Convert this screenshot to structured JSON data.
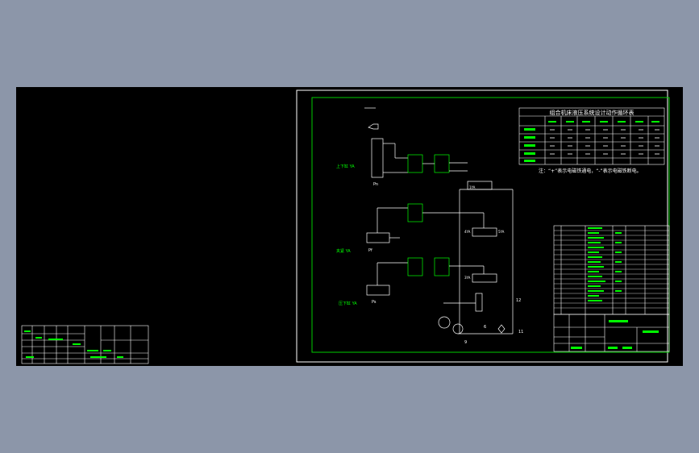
{
  "colors": {
    "background": "#8c96a9",
    "canvas": "#000000",
    "frame": "#ffffff",
    "border": "#00cc00",
    "accent": "#00ff00",
    "line": "#ffffff"
  },
  "labels": {
    "pn": "Pn",
    "pf": "Pf",
    "ps": "Ps",
    "note1": "注：“+”表示电磁铁通电，“-”表示电磁铁断电。",
    "cyl_up": "上下缸 YA",
    "cyl_left": "夹紧 YA",
    "cyl_right": "压下缸 YA",
    "v1": "1YA",
    "v2": "4YA",
    "v3": "3YA",
    "v4": "5YA",
    "num_12": "12",
    "num_11": "11",
    "num_6": "6",
    "num_9": "9"
  },
  "table": {
    "title": "组合机床液压系统设计动作循环表"
  }
}
